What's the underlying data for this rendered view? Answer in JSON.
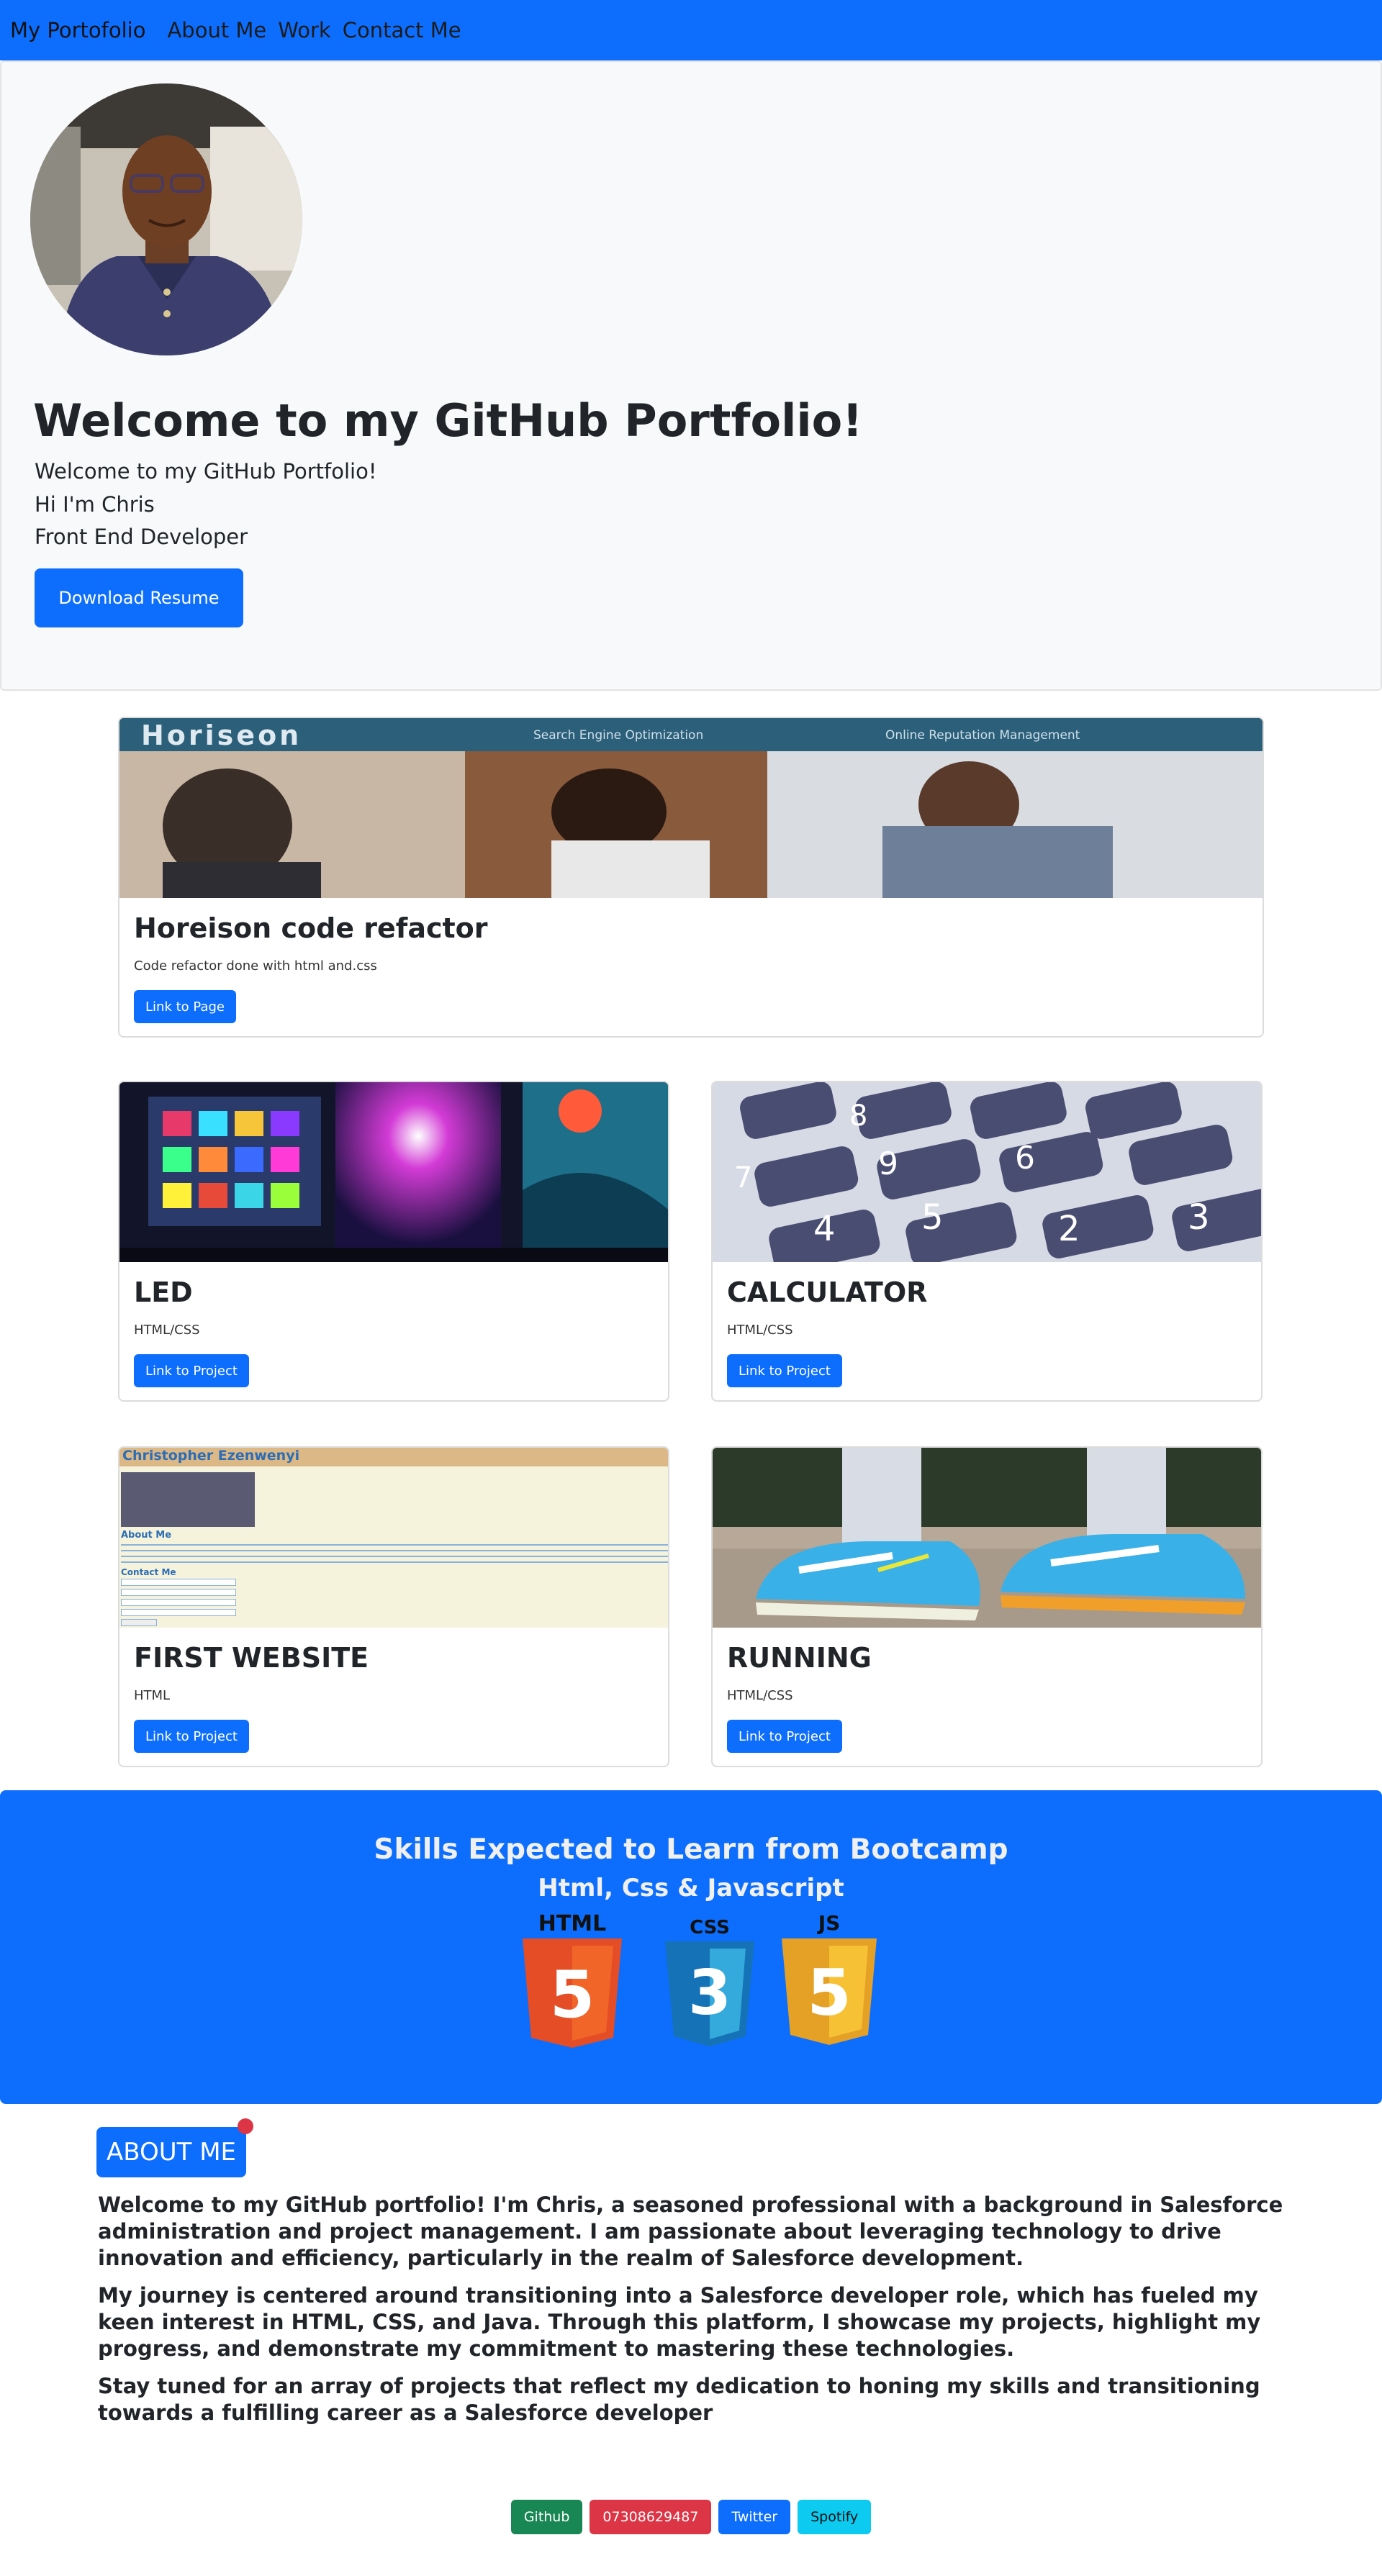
{
  "navbar": {
    "brand": "My Portofolio",
    "links": [
      "About Me",
      "Work",
      "Contact Me"
    ]
  },
  "hero": {
    "title": "Welcome to my GitHub Portfolio!",
    "line1": "Welcome to my GitHub Portfolio!",
    "line2": "Hi I'm Chris",
    "line3": "Front End Developer",
    "resume_button": "Download Resume"
  },
  "featured": {
    "banner_text": "Horiseon",
    "banner_links": [
      "Search Engine Optimization",
      "Online Reputation Management"
    ],
    "title": "Horeison code refactor",
    "text": "Code refactor done with html and.css",
    "button": "Link to Page"
  },
  "projects": [
    {
      "title": "LED",
      "text": "HTML/CSS",
      "button": "Link to Project"
    },
    {
      "title": "CALCULATOR",
      "text": "HTML/CSS",
      "button": "Link to Project",
      "keys": [
        "9",
        "8",
        "6",
        "5",
        "4",
        "3",
        "2",
        "7"
      ]
    },
    {
      "title": "FIRST WEBSITE",
      "text": "HTML",
      "button": "Link to Project"
    },
    {
      "title": "RUNNING",
      "text": "HTML/CSS",
      "button": "Link to Project"
    }
  ],
  "first_website_preview": {
    "name": "Christopher Ezenwenyi",
    "about": "About Me",
    "contact": "Contact Me"
  },
  "skills": {
    "title": "Skills Expected to Learn from Bootcamp",
    "subtitle": "Html, Css & Javascript",
    "logos": [
      {
        "label": "HTML",
        "number": "5",
        "color": "#e44d26",
        "shade": "#f16529"
      },
      {
        "label": "CSS",
        "number": "3",
        "color": "#1572b6",
        "shade": "#33a9dc"
      },
      {
        "label": "JS",
        "number": "5",
        "color": "#e4a126",
        "shade": "#f7c136"
      }
    ]
  },
  "about": {
    "badge": "ABOUT ME",
    "p1": "Welcome to my GitHub portfolio! I'm Chris, a seasoned professional with a background in Salesforce administration and project management. I am passionate about leveraging technology to drive innovation and efficiency, particularly in the realm of Salesforce development.",
    "p2": "My journey is centered around transitioning into a Salesforce developer role, which has fueled my keen interest in HTML, CSS, and Java. Through this platform, I showcase my projects, highlight my progress, and demonstrate my commitment to mastering these technologies.",
    "p3": "Stay tuned for an array of projects that reflect my dedication to honing my skills and transitioning towards a fulfilling career as a Salesforce developer"
  },
  "footer": {
    "buttons": [
      {
        "label": "Github",
        "color": "#198754"
      },
      {
        "label": "07308629487",
        "color": "#dc3545"
      },
      {
        "label": "Twitter",
        "color": "#0d6efd"
      },
      {
        "label": "Spotify",
        "color": "#0dcaf0"
      }
    ]
  },
  "colors": {
    "primary": "#0d6efd",
    "light": "#f8f9fa"
  }
}
